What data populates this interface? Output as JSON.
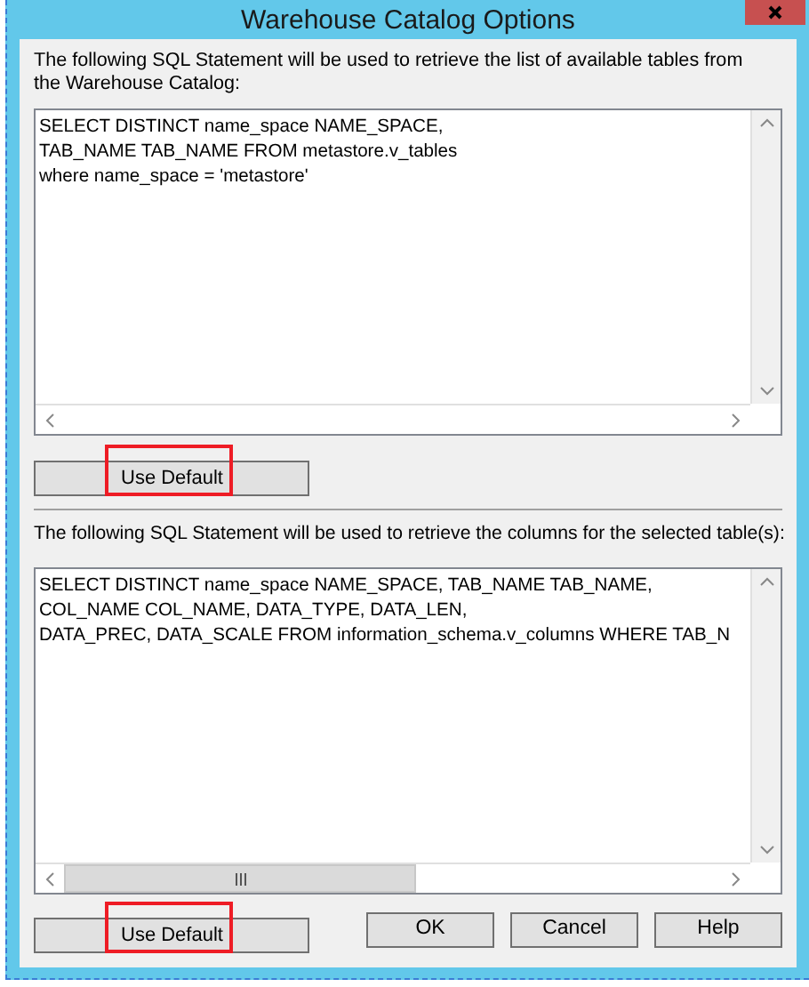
{
  "window": {
    "title": "Warehouse Catalog Options"
  },
  "sections": [
    {
      "label": "The following SQL Statement will be used to retrieve the list of available tables from the Warehouse Catalog:",
      "sql_lines": [
        "SELECT DISTINCT name_space NAME_SPACE,",
        "TAB_NAME TAB_NAME FROM metastore.v_tables",
        "where name_space = 'metastore'"
      ],
      "button": {
        "label": "Use Default",
        "highlighted": true
      }
    },
    {
      "label": "The following SQL Statement will be used to retrieve the columns for the selected table(s):",
      "sql_lines": [
        "SELECT DISTINCT name_space NAME_SPACE, TAB_NAME TAB_NAME,",
        "COL_NAME COL_NAME, DATA_TYPE, DATA_LEN,",
        "DATA_PREC, DATA_SCALE FROM information_schema.v_columns WHERE TAB_N"
      ],
      "button": {
        "label": "Use Default",
        "highlighted": true
      }
    }
  ],
  "buttons": [
    "OK",
    "Cancel",
    "Help"
  ]
}
